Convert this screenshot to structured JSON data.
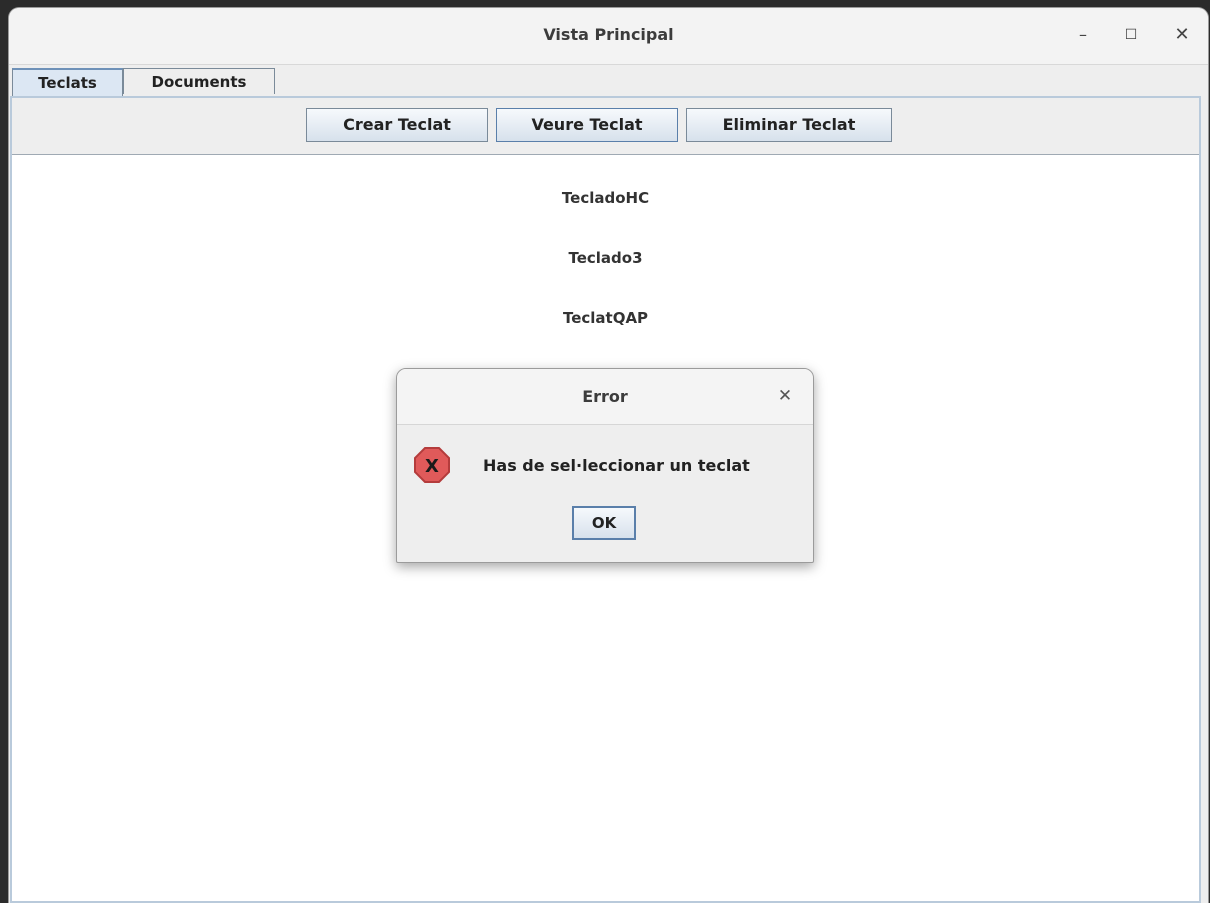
{
  "window": {
    "title": "Vista Principal",
    "minimize_glyph": "–",
    "maximize_glyph": "☐",
    "close_glyph": "✕"
  },
  "tabs": [
    {
      "label": "Teclats",
      "active": true
    },
    {
      "label": "Documents",
      "active": false
    }
  ],
  "toolbar": {
    "create_label": "Crear Teclat",
    "view_label": "Veure Teclat",
    "delete_label": "Eliminar Teclat"
  },
  "keyboards": [
    {
      "name": "TecladoHC"
    },
    {
      "name": "Teclado3"
    },
    {
      "name": "TeclatQAP"
    }
  ],
  "dialog": {
    "title": "Error",
    "close_glyph": "✕",
    "icon": "error-icon",
    "icon_letter": "X",
    "message": "Has de sel·leccionar un teclat",
    "ok_label": "OK"
  },
  "colors": {
    "error_icon_fill": "#e05a5a",
    "error_icon_border": "#b43c3c",
    "tab_active_bg": "#dce7f3",
    "button_border": "#7a8a99"
  }
}
